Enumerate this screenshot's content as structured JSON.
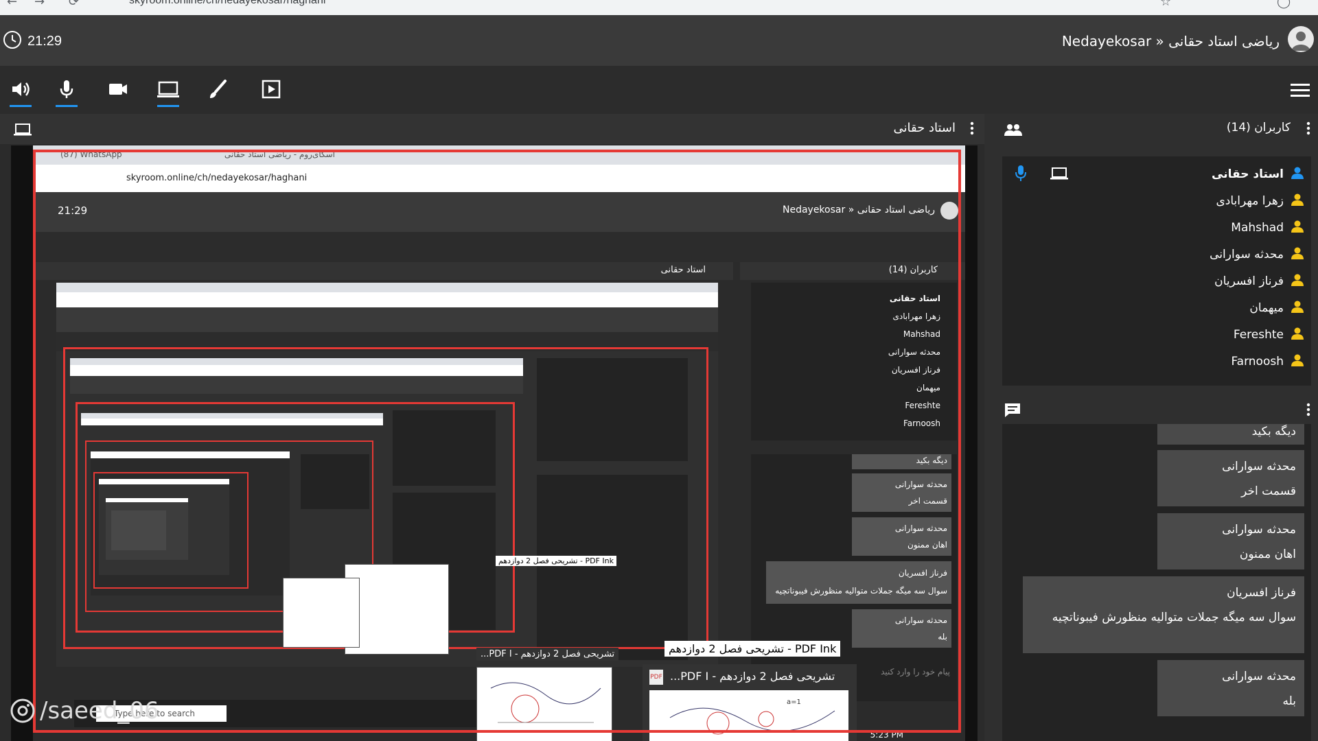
{
  "browser": {
    "url": "skyroom.online/ch/nedayekosar/haghani"
  },
  "header": {
    "time": "21:29",
    "room_title": "Nedayekosar » ریاضی استاد حقانی"
  },
  "toolbar": {
    "tools": [
      "speaker-icon",
      "microphone-icon",
      "camera-icon",
      "screen-share-icon",
      "brush-icon",
      "play-media-icon"
    ],
    "accent": "#2196f3"
  },
  "main": {
    "presenter": "استاد حقانی"
  },
  "inner": {
    "tab1": "(87) WhatsApp",
    "tab2": "اسکای‌روم - ریاضی استاد حقانی",
    "url": "skyroom.online/ch/nedayekosar/haghani",
    "time": "21:29",
    "room_title": "Nedayekosar » ریاضی استاد حقانی",
    "presenter": "استاد حقانی",
    "users_title": "کاربران (14)",
    "chat_placeholder": "پیام خود را وارد کنید",
    "taskbar_search": "Type here to search",
    "taskbar_time": "5:23 PM"
  },
  "users": {
    "title": "کاربران (14)",
    "list": [
      {
        "name": "استاد حقانی"
      },
      {
        "name": "زهرا مهرابادی"
      },
      {
        "name": "Mahshad"
      },
      {
        "name": "محدثه سوارانی"
      },
      {
        "name": "فرناز افسریان"
      },
      {
        "name": "میهمان"
      },
      {
        "name": "Fereshte"
      },
      {
        "name": "Farnoosh"
      }
    ]
  },
  "chat": {
    "messages": [
      {
        "sender": "",
        "text": "دیگه بکید"
      },
      {
        "sender": "محدثه سوارانی",
        "text": "قسمت اخر"
      },
      {
        "sender": "محدثه سوارانی",
        "text": "اهان ممنون"
      },
      {
        "sender": "فرناز افسریان",
        "text": "سوال سه میگه جملات متوالیه منظورش فیبوناتچیه"
      },
      {
        "sender": "محدثه سوارانی",
        "text": "بله"
      }
    ]
  },
  "thumbnails": {
    "label_a": "PDF Ink - تشریحی فصل 2 دوازدهم",
    "label_b": "تشریحی فصل 2 دوازدهم - PDF I...",
    "label_c": "تشریحی فصل 2 دوازدهم - PDF I..."
  },
  "watermark": "/saeed_06"
}
